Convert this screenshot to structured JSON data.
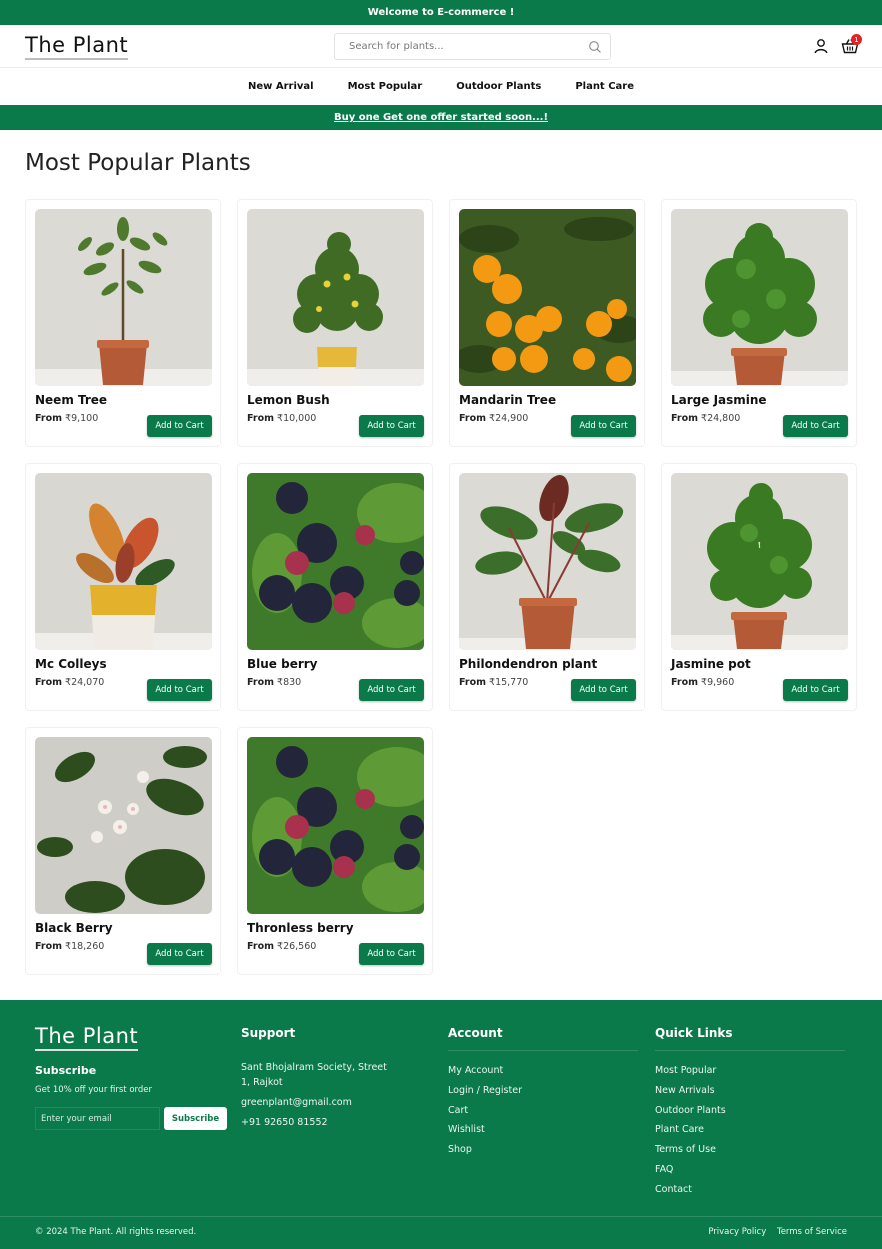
{
  "topbar": {
    "text": "Welcome to E-commerce !"
  },
  "header": {
    "logo": "The Plant",
    "search_placeholder": "Search for plants...",
    "cart_count": "1"
  },
  "nav": {
    "items": [
      "New Arrival",
      "Most Popular",
      "Outdoor Plants",
      "Plant Care"
    ]
  },
  "offer": {
    "text": "Buy one Get one offer started soon...!"
  },
  "section": {
    "title": "Most Popular Plants"
  },
  "products": [
    {
      "name": "Neem Tree",
      "from": "From",
      "price": "₹9,100",
      "button": "Add to Cart",
      "image": "tall tree in clay pot"
    },
    {
      "name": "Lemon Bush",
      "from": "From",
      "price": "₹10,000",
      "button": "Add to Cart",
      "image": "lemon bush in yellow pot"
    },
    {
      "name": "Mandarin Tree",
      "from": "From",
      "price": "₹24,900",
      "button": "Add to Cart",
      "image": "mandarin oranges close-up"
    },
    {
      "name": "Large Jasmine",
      "from": "From",
      "price": "₹24,800",
      "button": "Add to Cart",
      "image": "bushy jasmine in clay pot"
    },
    {
      "name": "Mc Colleys",
      "from": "From",
      "price": "₹24,070",
      "button": "Add to Cart",
      "image": "orange-leaf plant in yellow pot"
    },
    {
      "name": "Blue berry",
      "from": "From",
      "price": "₹830",
      "button": "Add to Cart",
      "image": "berries close-up"
    },
    {
      "name": "Philondendron plant",
      "from": "From",
      "price": "₹15,770",
      "button": "Add to Cart",
      "image": "philodendron in clay pot"
    },
    {
      "name": "Jasmine pot",
      "from": "From",
      "price": "₹9,960",
      "button": "Add to Cart",
      "image": "jasmine bush in clay pot"
    },
    {
      "name": "Black Berry",
      "from": "From",
      "price": "₹18,260",
      "button": "Add to Cart",
      "image": "blackberry flowers"
    },
    {
      "name": "Thronless berry",
      "from": "From",
      "price": "₹26,560",
      "button": "Add to Cart",
      "image": "berries close-up"
    }
  ],
  "footer": {
    "logo": "The Plant",
    "subscribe_title": "Subscribe",
    "subscribe_sub": "Get 10% off your first order",
    "email_placeholder": "Enter your email",
    "subscribe_button": "Subscribe",
    "support": {
      "title": "Support",
      "address": "Sant Bhojalram Society, Street 1, Rajkot",
      "email": "greenplant@gmail.com",
      "phone": "+91 92650 81552"
    },
    "account": {
      "title": "Account",
      "links": [
        "My Account",
        "Login / Register",
        "Cart",
        "Wishlist",
        "Shop"
      ]
    },
    "quick_links": {
      "title": "Quick Links",
      "links": [
        "Most Popular",
        "New Arrivals",
        "Outdoor Plants",
        "Plant Care",
        "Terms of Use",
        "FAQ",
        "Contact"
      ]
    },
    "copyright": "© 2024 The Plant. All rights reserved.",
    "legal": [
      "Privacy Policy",
      "Terms of Service"
    ]
  },
  "colors": {
    "brand_green": "#0b7a4b",
    "badge_red": "#e02424"
  },
  "icons": [
    "search-icon",
    "user-icon",
    "cart-icon"
  ]
}
